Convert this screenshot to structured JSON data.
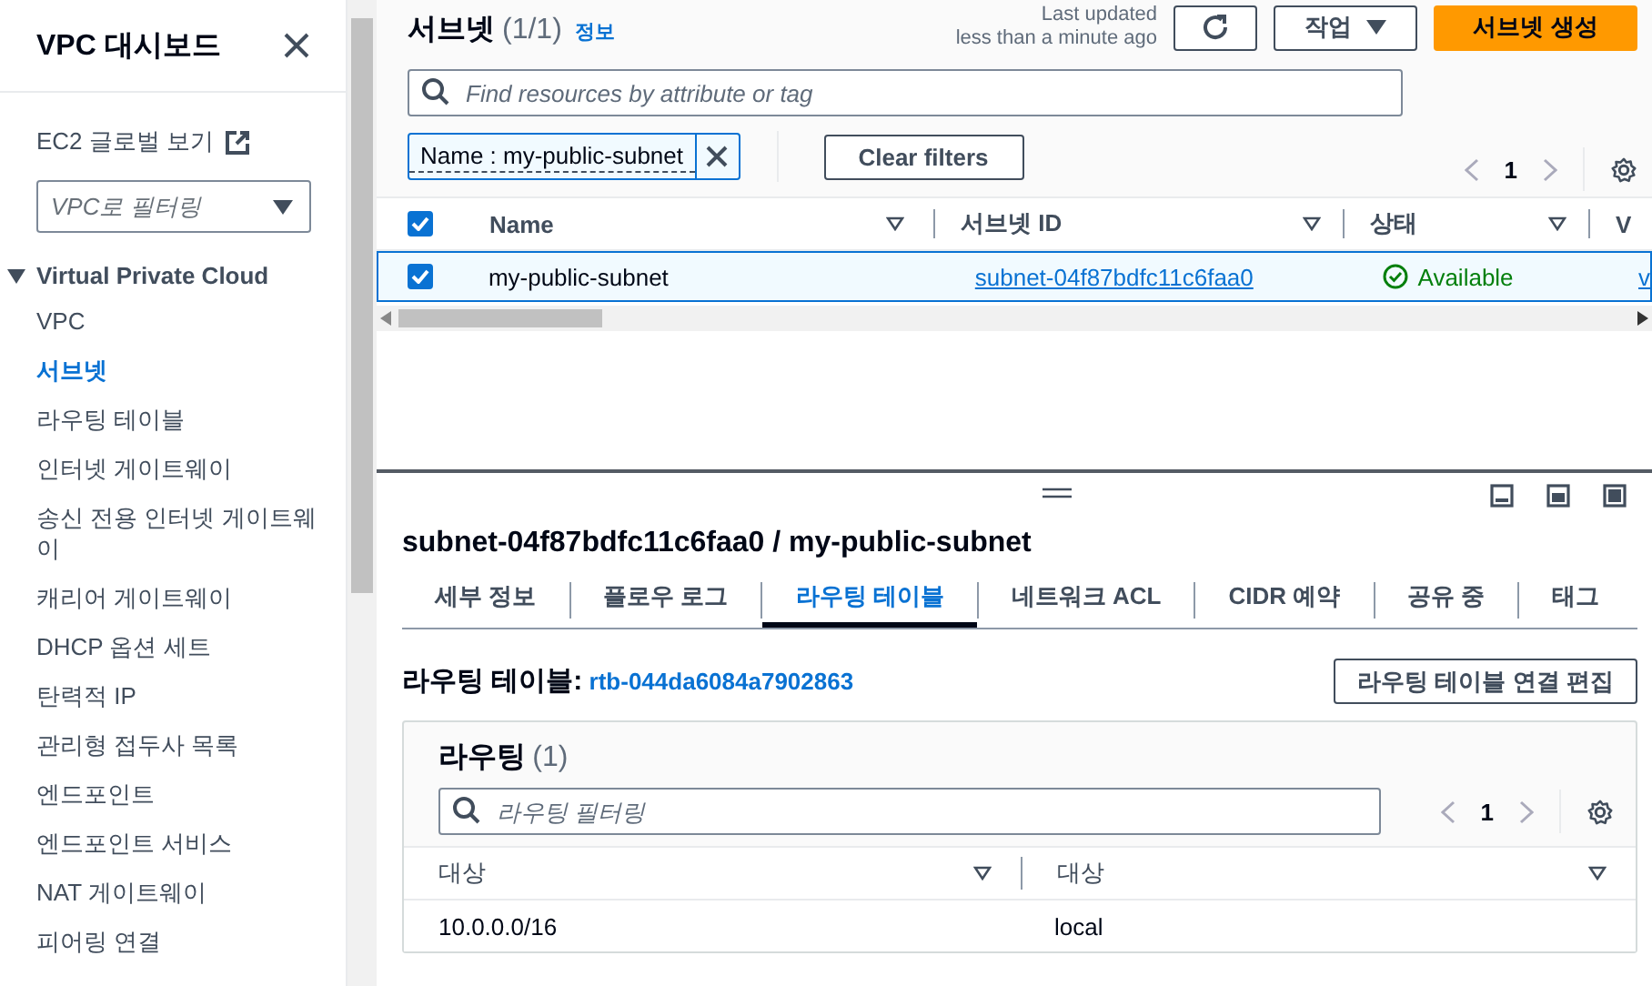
{
  "sidebar": {
    "title": "VPC 대시보드",
    "global_view_link": "EC2 글로벌 보기",
    "vpc_filter": {
      "placeholder": "VPC로 필터링"
    },
    "section": {
      "label": "Virtual Private Cloud",
      "expanded": true,
      "items": [
        {
          "label": "VPC",
          "selected": false
        },
        {
          "label": "서브넷",
          "selected": true
        },
        {
          "label": "라우팅 테이블",
          "selected": false
        },
        {
          "label": "인터넷 게이트웨이",
          "selected": false
        },
        {
          "label": "송신 전용 인터넷 게이트웨이",
          "selected": false
        },
        {
          "label": "캐리어 게이트웨이",
          "selected": false
        },
        {
          "label": "DHCP 옵션 세트",
          "selected": false
        },
        {
          "label": "탄력적 IP",
          "selected": false
        },
        {
          "label": "관리형 접두사 목록",
          "selected": false
        },
        {
          "label": "엔드포인트",
          "selected": false
        },
        {
          "label": "엔드포인트 서비스",
          "selected": false
        },
        {
          "label": "NAT 게이트웨이",
          "selected": false
        },
        {
          "label": "피어링 연결",
          "selected": false
        }
      ]
    }
  },
  "header": {
    "title": "서브넷",
    "count": "(1/1)",
    "info_link": "정보",
    "last_updated": [
      "Last updated",
      "less than a minute ago"
    ],
    "actions_button": "작업",
    "create_button": "서브넷 생성"
  },
  "search": {
    "placeholder": "Find resources by attribute or tag"
  },
  "filter_token": {
    "label": "Name : my-public-subnet"
  },
  "clear_filters": "Clear filters",
  "pagination": {
    "page": "1"
  },
  "table": {
    "all_checked": true,
    "columns": [
      "Name",
      "서브넷 ID",
      "상태",
      "V"
    ],
    "rows": [
      {
        "selected": true,
        "name": "my-public-subnet",
        "subnet_id": "subnet-04f87bdfc11c6faa0",
        "status": "Available",
        "column_4": "v"
      }
    ]
  },
  "details": {
    "title": "subnet-04f87bdfc11c6faa0 / my-public-subnet",
    "tabs": [
      {
        "label": "세부 정보",
        "selected": false
      },
      {
        "label": "플로우 로그",
        "selected": false
      },
      {
        "label": "라우팅 테이블",
        "selected": true
      },
      {
        "label": "네트워크 ACL",
        "selected": false
      },
      {
        "label": "CIDR 예약",
        "selected": false
      },
      {
        "label": "공유 중",
        "selected": false
      },
      {
        "label": "태그",
        "selected": false
      }
    ],
    "route_table_label": "라우팅 테이블:",
    "route_table_link": "rtb-044da6084a7902863",
    "edit_button": "라우팅 테이블 연결 편집",
    "routes": {
      "title": "라우팅",
      "count": "(1)",
      "search": {
        "placeholder": "라우팅 필터링"
      },
      "page": "1",
      "columns": [
        "대상",
        "대상"
      ],
      "rows": [
        [
          "10.0.0.0/16",
          "local"
        ]
      ]
    }
  }
}
